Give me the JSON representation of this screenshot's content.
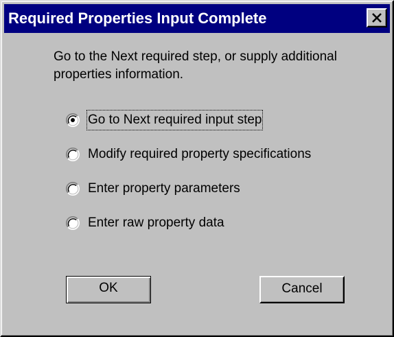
{
  "window": {
    "title": "Required Properties Input Complete",
    "close_icon": "close-icon"
  },
  "message": "Go to the Next required step, or supply additional properties information.",
  "options": [
    {
      "label": "Go to Next required input step",
      "selected": true
    },
    {
      "label": "Modify required property specifications",
      "selected": false
    },
    {
      "label": "Enter property parameters",
      "selected": false
    },
    {
      "label": "Enter raw property data",
      "selected": false
    }
  ],
  "buttons": {
    "ok_label": "OK",
    "cancel_label": "Cancel"
  },
  "colors": {
    "titlebar": "#000080",
    "face": "#c0c0c0"
  }
}
